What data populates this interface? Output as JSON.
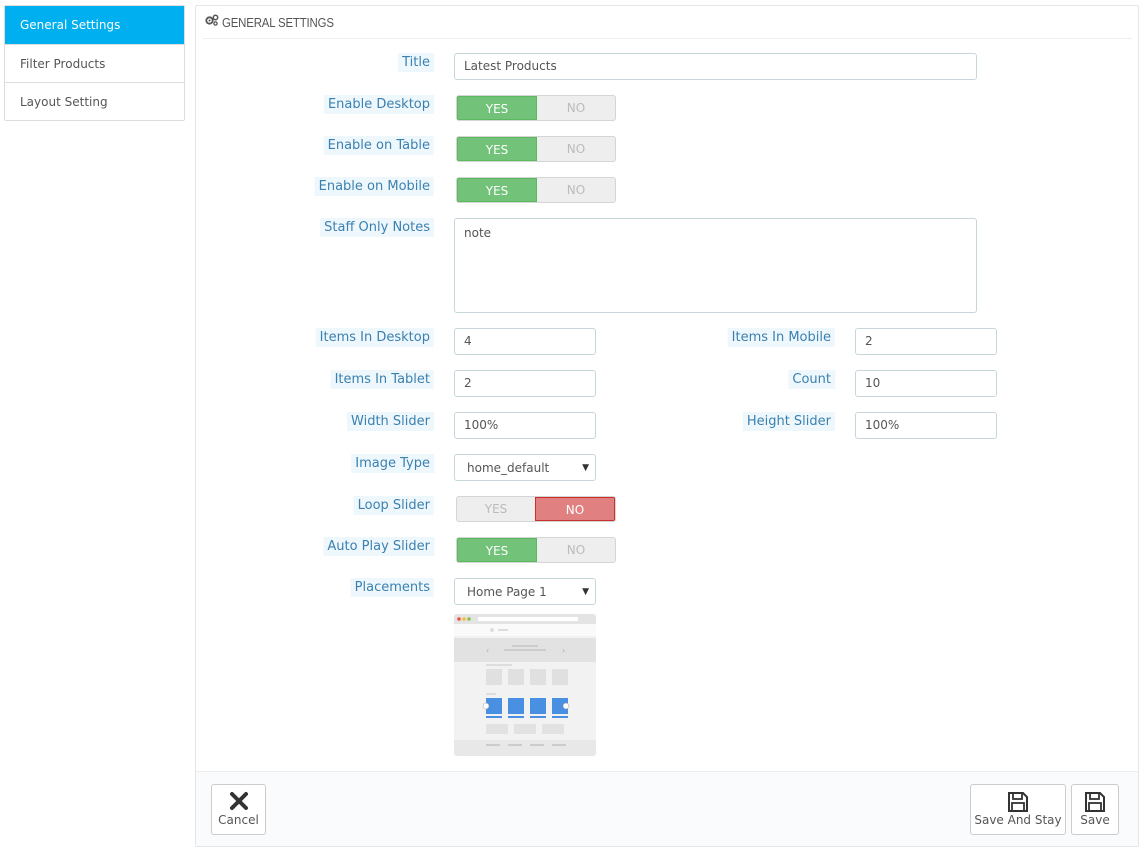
{
  "sidebar": {
    "items": [
      {
        "label": "General Settings",
        "active": true
      },
      {
        "label": "Filter Products",
        "active": false
      },
      {
        "label": "Layout Setting",
        "active": false
      }
    ]
  },
  "panel": {
    "heading": "GENERAL SETTINGS",
    "heading_icon": "gears-icon"
  },
  "form": {
    "title": {
      "label": "Title",
      "value": "Latest Products"
    },
    "enable_desktop": {
      "label": "Enable Desktop",
      "yes": "YES",
      "no": "NO",
      "selected": "YES"
    },
    "enable_table": {
      "label": "Enable on Table",
      "yes": "YES",
      "no": "NO",
      "selected": "YES"
    },
    "enable_mobile": {
      "label": "Enable on Mobile",
      "yes": "YES",
      "no": "NO",
      "selected": "YES"
    },
    "staff_notes": {
      "label": "Staff Only Notes",
      "value": "note"
    },
    "items_desktop": {
      "label": "Items In Desktop",
      "value": "4"
    },
    "items_mobile": {
      "label": "Items In Mobile",
      "value": "2"
    },
    "items_tablet": {
      "label": "Items In Tablet",
      "value": "2"
    },
    "count": {
      "label": "Count",
      "value": "10"
    },
    "width_slider": {
      "label": "Width Slider",
      "value": "100%"
    },
    "height_slider": {
      "label": "Height Slider",
      "value": "100%"
    },
    "image_type": {
      "label": "Image Type",
      "value": "home_default"
    },
    "loop_slider": {
      "label": "Loop Slider",
      "yes": "YES",
      "no": "NO",
      "selected": "NO"
    },
    "autoplay_slider": {
      "label": "Auto Play Slider",
      "yes": "YES",
      "no": "NO",
      "selected": "YES"
    },
    "placements": {
      "label": "Placements",
      "value": "Home Page 1"
    }
  },
  "footer": {
    "cancel_label": "Cancel",
    "save_stay_label": "Save And Stay",
    "save_label": "Save"
  },
  "colors": {
    "accent": "#00aff0",
    "switch_yes": "#72c279",
    "switch_no": "#e08080",
    "label_text": "#3b81b0"
  }
}
